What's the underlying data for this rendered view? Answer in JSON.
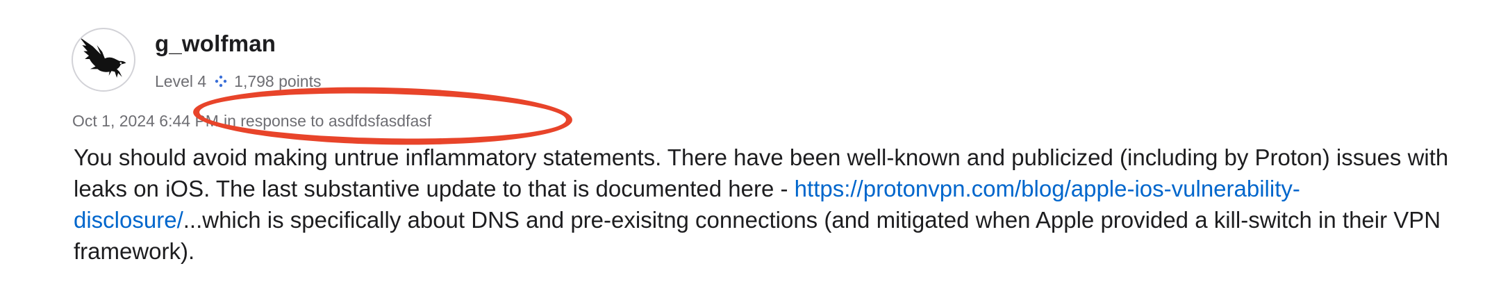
{
  "post": {
    "author": {
      "username": "g_wolfman",
      "avatar_icon": "raven-bird-icon",
      "level": "Level 4",
      "points_icon": "sparkle-dots-icon",
      "points": "1,798 points"
    },
    "timestamp": "Oct 1, 2024 6:44 PM",
    "reply_to_text": "in response to asdfdsfasdfasf",
    "body": {
      "text_before_link": "You should avoid making untrue inflammatory statements. There have been well-known and publicized (including by Proton) issues with leaks on iOS. The last substantive update to that is documented here - ",
      "link_text": "https://protonvpn.com/blog/apple-ios-vulnerability-disclosure/",
      "text_after_link": "...which is specifically about DNS and pre-exisitng connections (and mitigated when Apple provided a kill-switch in their VPN framework)."
    }
  },
  "annotation": {
    "shape": "oval",
    "color": "#e8442a"
  },
  "colors": {
    "text_primary": "#1d1d1f",
    "text_secondary": "#6e6e73",
    "link": "#0066cc",
    "points_icon": "#3a6fd8"
  }
}
